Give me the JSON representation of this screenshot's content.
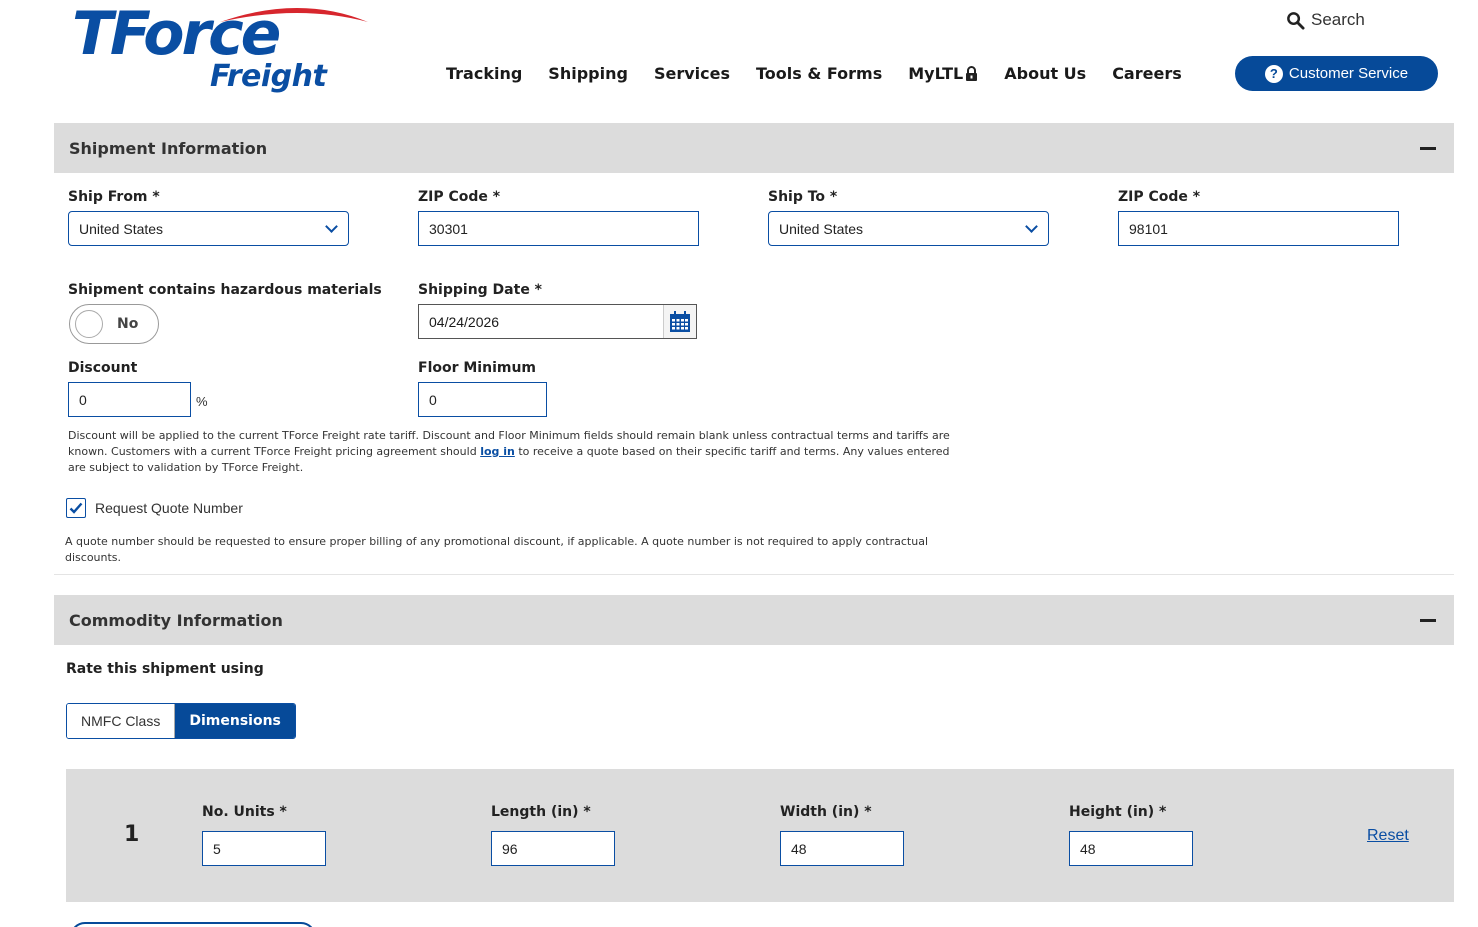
{
  "header": {
    "logo_primary": "TForce",
    "logo_secondary": "Freight",
    "search_label": "Search",
    "nav": [
      {
        "label": "Tracking"
      },
      {
        "label": "Shipping"
      },
      {
        "label": "Services"
      },
      {
        "label": "Tools & Forms"
      },
      {
        "label": "MyLTL"
      },
      {
        "label": "About Us"
      },
      {
        "label": "Careers"
      }
    ],
    "customer_service_label": "Customer Service"
  },
  "shipment": {
    "title": "Shipment Information",
    "ship_from_label": "Ship From *",
    "ship_from_value": "United States",
    "from_zip_label": "ZIP Code *",
    "from_zip_value": "30301",
    "ship_to_label": "Ship To *",
    "ship_to_value": "United States",
    "to_zip_label": "ZIP Code *",
    "to_zip_value": "98101",
    "hazmat_label": "Shipment contains hazardous materials",
    "hazmat_value": "No",
    "date_label": "Shipping Date *",
    "date_value": "04/24/2026",
    "discount_label": "Discount",
    "discount_value": "0",
    "percent_sign": "%",
    "floor_label": "Floor Minimum",
    "floor_value": "0",
    "note_part1": "Discount will be applied to the current TForce Freight rate tariff. Discount and Floor Minimum fields should remain blank unless contractual terms and tariffs are known. Customers with a current TForce Freight pricing agreement should ",
    "note_link": "log in",
    "note_part2": " to receive a quote based on their specific tariff and terms. Any values entered are subject to validation by TForce Freight.",
    "quote_checkbox_label": "Request Quote Number",
    "quote_checked": true,
    "quote_note": "A quote number should be requested to ensure proper billing of any promotional discount, if applicable. A quote number is not required to apply contractual discounts."
  },
  "commodity": {
    "title": "Commodity Information",
    "rate_label": "Rate this shipment using",
    "rate_options": [
      "NMFC Class",
      "Dimensions"
    ],
    "rate_selected": "Dimensions",
    "item": {
      "number": "1",
      "units_label": "No. Units *",
      "units_value": "5",
      "length_label": "Length (in) *",
      "length_value": "96",
      "width_label": "Width (in) *",
      "width_value": "48",
      "height_label": "Height (in) *",
      "height_value": "48",
      "reset_label": "Reset"
    }
  },
  "colors": {
    "brand_blue": "#064a99",
    "logo_blue": "#0a4ea3",
    "logo_red": "#d7262d",
    "section_gray": "#dcdcdc"
  }
}
